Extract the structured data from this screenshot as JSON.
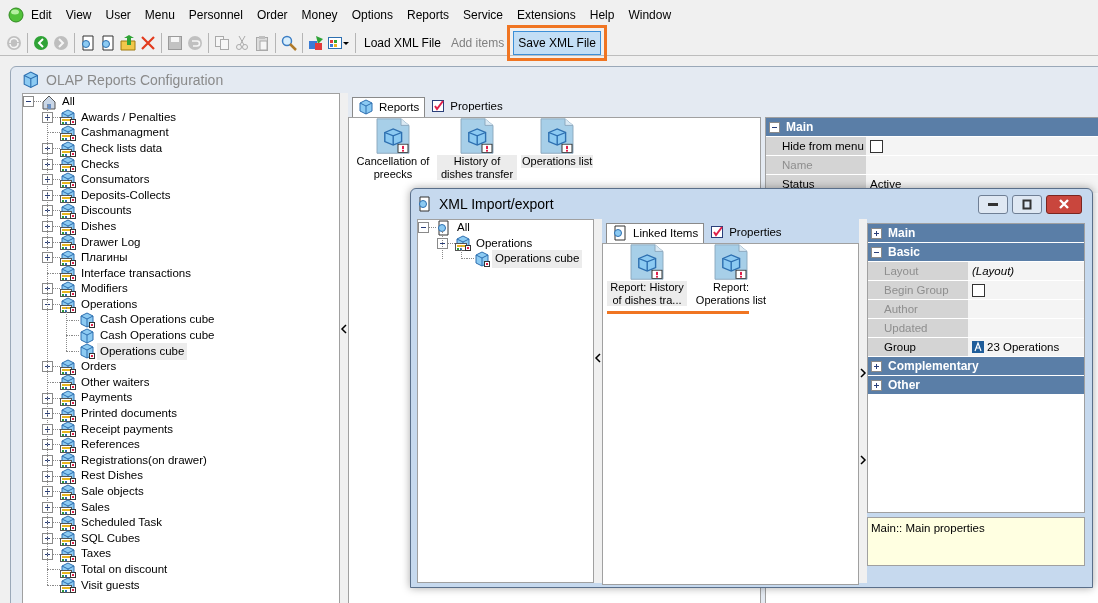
{
  "menu_bar": {
    "items": [
      "Edit",
      "View",
      "User",
      "Menu",
      "Personnel",
      "Order",
      "Money",
      "Options",
      "Reports",
      "Service",
      "Extensions",
      "Help",
      "Window"
    ]
  },
  "toolbar": {
    "icons": [
      {
        "disabled": true
      },
      {
        "disabled": false
      },
      {
        "disabled": true
      },
      {
        "disabled": false
      },
      {
        "disabled": false
      },
      {
        "disabled": false
      },
      {
        "disabled": false
      },
      {
        "disabled": true
      },
      {
        "disabled": true
      },
      {
        "disabled": true
      },
      {
        "disabled": true
      },
      {
        "disabled": true
      },
      {
        "disabled": false
      },
      {
        "disabled": false
      },
      {
        "disabled": false
      }
    ],
    "text_buttons": [
      {
        "label": "Load XML File",
        "disabled": false,
        "highlighted": false
      },
      {
        "label": "Add items",
        "disabled": true,
        "highlighted": false
      },
      {
        "label": "Save XML File",
        "disabled": false,
        "highlighted": true
      }
    ]
  },
  "olap_window": {
    "title": "OLAP Reports Configuration",
    "tree": [
      {
        "label": "All",
        "kind": "root-house",
        "expandable": true,
        "expanded": true,
        "selected": false,
        "children": [
          {
            "label": "Awards / Penalties",
            "kind": "group",
            "expandable": true,
            "expanded": false,
            "selected": false
          },
          {
            "label": "Cashmanagment",
            "kind": "group",
            "expandable": false,
            "expanded": false,
            "selected": false
          },
          {
            "label": "Check lists data",
            "kind": "group",
            "expandable": true,
            "expanded": false,
            "selected": false
          },
          {
            "label": "Checks",
            "kind": "group",
            "expandable": true,
            "expanded": false,
            "selected": false
          },
          {
            "label": "Consumators",
            "kind": "group",
            "expandable": true,
            "expanded": false,
            "selected": false
          },
          {
            "label": "Deposits-Collects",
            "kind": "group",
            "expandable": true,
            "expanded": false,
            "selected": false
          },
          {
            "label": "Discounts",
            "kind": "group",
            "expandable": true,
            "expanded": false,
            "selected": false
          },
          {
            "label": "Dishes",
            "kind": "group",
            "expandable": true,
            "expanded": false,
            "selected": false
          },
          {
            "label": "Drawer Log",
            "kind": "group",
            "expandable": true,
            "expanded": false,
            "selected": false
          },
          {
            "label": "Плагины",
            "kind": "group",
            "expandable": true,
            "expanded": false,
            "selected": false
          },
          {
            "label": "Interface transactions",
            "kind": "group",
            "expandable": false,
            "expanded": false,
            "selected": false
          },
          {
            "label": "Modifiers",
            "kind": "group",
            "expandable": true,
            "expanded": false,
            "selected": false
          },
          {
            "label": "Operations",
            "kind": "group",
            "expandable": true,
            "expanded": true,
            "selected": false,
            "children": [
              {
                "label": "Cash Operations cube",
                "kind": "cube-flagged",
                "expandable": false,
                "expanded": false,
                "selected": false
              },
              {
                "label": "Cash Operations cube",
                "kind": "cube",
                "expandable": false,
                "expanded": false,
                "selected": false
              },
              {
                "label": "Operations cube",
                "kind": "cube-flagged",
                "expandable": false,
                "expanded": false,
                "selected": true
              }
            ]
          },
          {
            "label": "Orders",
            "kind": "group",
            "expandable": true,
            "expanded": false,
            "selected": false
          },
          {
            "label": "Other waiters",
            "kind": "group",
            "expandable": false,
            "expanded": false,
            "selected": false
          },
          {
            "label": "Payments",
            "kind": "group",
            "expandable": true,
            "expanded": false,
            "selected": false
          },
          {
            "label": "Printed documents",
            "kind": "group",
            "expandable": true,
            "expanded": false,
            "selected": false
          },
          {
            "label": "Receipt payments",
            "kind": "group",
            "expandable": true,
            "expanded": false,
            "selected": false
          },
          {
            "label": "References",
            "kind": "group",
            "expandable": true,
            "expanded": false,
            "selected": false
          },
          {
            "label": "Registrations(on drawer)",
            "kind": "group",
            "expandable": true,
            "expanded": false,
            "selected": false
          },
          {
            "label": "Rest Dishes",
            "kind": "group",
            "expandable": true,
            "expanded": false,
            "selected": false
          },
          {
            "label": "Sale objects",
            "kind": "group",
            "expandable": true,
            "expanded": false,
            "selected": false
          },
          {
            "label": "Sales",
            "kind": "group",
            "expandable": true,
            "expanded": false,
            "selected": false
          },
          {
            "label": "Scheduled Task",
            "kind": "group",
            "expandable": true,
            "expanded": false,
            "selected": false
          },
          {
            "label": "SQL Cubes",
            "kind": "group",
            "expandable": true,
            "expanded": false,
            "selected": false
          },
          {
            "label": "Taxes",
            "kind": "group",
            "expandable": true,
            "expanded": false,
            "selected": false
          },
          {
            "label": "Total on discount",
            "kind": "group",
            "expandable": false,
            "expanded": false,
            "selected": false
          },
          {
            "label": "Visit guests",
            "kind": "group",
            "expandable": false,
            "expanded": false,
            "selected": false
          }
        ]
      }
    ],
    "tabs": [
      {
        "label": "Reports",
        "selected": true
      },
      {
        "label": "Properties",
        "selected": false
      }
    ],
    "reports": [
      {
        "label": "Cancellation of preecks",
        "selected": false
      },
      {
        "label": "History of dishes transfer",
        "selected": true
      },
      {
        "label": "Operations list",
        "selected": true
      }
    ],
    "properties": {
      "sections": [
        {
          "title": "Main",
          "expanded": true,
          "rows": [
            {
              "label": "Hide from menu",
              "kind": "checkbox",
              "checked": false,
              "disabled": false
            },
            {
              "label": "Name",
              "kind": "text",
              "disabled": true
            },
            {
              "label": "Status",
              "kind": "text",
              "value": "Active",
              "disabled": false
            }
          ]
        }
      ]
    }
  },
  "import_dialog": {
    "title": "XML Import/export",
    "tree": [
      {
        "label": "All",
        "kind": "root-doc",
        "expandable": true,
        "expanded": true,
        "selected": false,
        "children": [
          {
            "label": "Operations",
            "kind": "group",
            "expandable": true,
            "expanded": true,
            "selected": false,
            "children": [
              {
                "label": "Operations cube",
                "kind": "cube-flagged",
                "expandable": false,
                "expanded": false,
                "selected": true
              }
            ]
          }
        ]
      }
    ],
    "tabs": [
      {
        "label": "Linked Items",
        "selected": true
      },
      {
        "label": "Properties",
        "selected": false
      }
    ],
    "linked_items": [
      {
        "label": "Report: History of dishes tra...",
        "selected": true
      },
      {
        "label": "Report: Operations list",
        "selected": false
      }
    ],
    "linked_items_underlined": true,
    "properties": {
      "sections": [
        {
          "title": "Main",
          "expanded": false
        },
        {
          "title": "Basic",
          "expanded": true,
          "rows": [
            {
              "label": "Layout",
              "kind": "italic",
              "value": "(Layout)",
              "disabled": true
            },
            {
              "label": "Begin Group",
              "kind": "checkbox",
              "checked": false,
              "disabled": true
            },
            {
              "label": "Author",
              "kind": "text",
              "disabled": true
            },
            {
              "label": "Updated",
              "kind": "text",
              "disabled": true
            },
            {
              "label": "Group",
              "kind": "enum",
              "value": "23 Operations",
              "disabled": false
            }
          ]
        },
        {
          "title": "Complementary",
          "expanded": false
        },
        {
          "title": "Other",
          "expanded": false
        }
      ]
    },
    "description": "Main:: Main properties"
  }
}
